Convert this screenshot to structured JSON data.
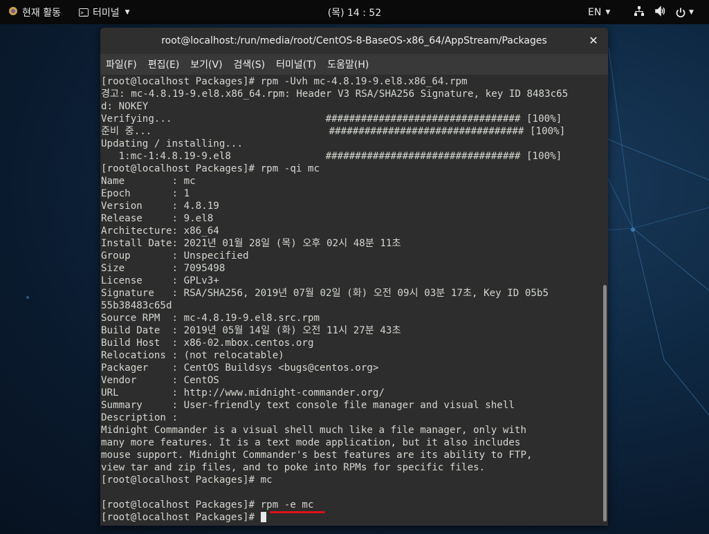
{
  "topbar": {
    "activities_label": "현재 활동",
    "app_menu_label": "터미널",
    "clock": "(목) 14 : 52",
    "language": "EN"
  },
  "window": {
    "title": "root@localhost:/run/media/root/CentOS-8-BaseOS-x86_64/AppStream/Packages",
    "close_glyph": "✕"
  },
  "menu": [
    "파일(F)",
    "편집(E)",
    "보기(V)",
    "검색(S)",
    "터미널(T)",
    "도움말(H)"
  ],
  "terminal_lines": [
    "[root@localhost Packages]# rpm -Uvh mc-4.8.19-9.el8.x86_64.rpm",
    "경고: mc-4.8.19-9.el8.x86_64.rpm: Header V3 RSA/SHA256 Signature, key ID 8483c65",
    "d: NOKEY",
    "Verifying...                          ################################# [100%]",
    "준비 중...                              ################################# [100%]",
    "Updating / installing...",
    "   1:mc-1:4.8.19-9.el8                ################################# [100%]",
    "[root@localhost Packages]# rpm -qi mc",
    "Name        : mc",
    "Epoch       : 1",
    "Version     : 4.8.19",
    "Release     : 9.el8",
    "Architecture: x86_64",
    "Install Date: 2021년 01월 28일 (목) 오후 02시 48분 11초",
    "Group       : Unspecified",
    "Size        : 7095498",
    "License     : GPLv3+",
    "Signature   : RSA/SHA256, 2019년 07월 02일 (화) 오전 09시 03분 17초, Key ID 05b5",
    "55b38483c65d",
    "Source RPM  : mc-4.8.19-9.el8.src.rpm",
    "Build Date  : 2019년 05월 14일 (화) 오전 11시 27분 43초",
    "Build Host  : x86-02.mbox.centos.org",
    "Relocations : (not relocatable)",
    "Packager    : CentOS Buildsys <bugs@centos.org>",
    "Vendor      : CentOS",
    "URL         : http://www.midnight-commander.org/",
    "Summary     : User-friendly text console file manager and visual shell",
    "Description :",
    "Midnight Commander is a visual shell much like a file manager, only with",
    "many more features. It is a text mode application, but it also includes",
    "mouse support. Midnight Commander's best features are its ability to FTP,",
    "view tar and zip files, and to poke into RPMs for specific files.",
    "[root@localhost Packages]# mc",
    "",
    "[root@localhost Packages]# rpm -e mc"
  ],
  "prompt_last": "[root@localhost Packages]# ",
  "icons": {
    "activities": "app-grid-icon",
    "network": "network-icon",
    "volume": "volume-icon",
    "power": "power-icon"
  },
  "colors": {
    "highlight_underline": "#e0101a",
    "terminal_bg": "#2d2d2d",
    "terminal_fg": "#d3d7cf"
  }
}
